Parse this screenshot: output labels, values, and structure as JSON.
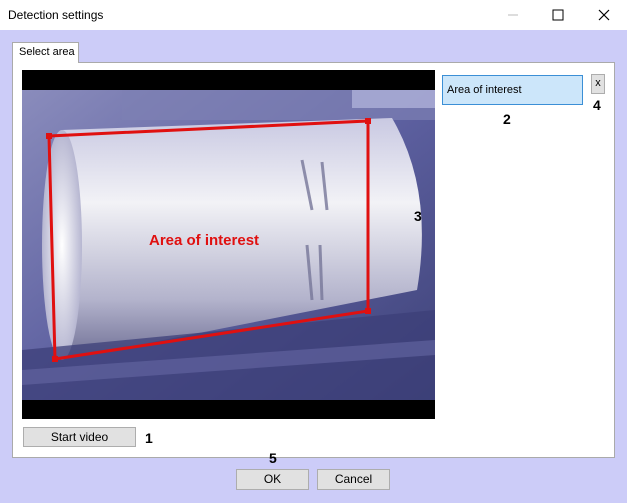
{
  "window": {
    "title": "Detection settings",
    "minimize_icon": "minimize-icon",
    "maximize_icon": "maximize-icon",
    "close_icon": "close-icon"
  },
  "tabs": [
    {
      "label": "Select area",
      "active": true
    }
  ],
  "video": {
    "overlay_label": "Area of interest",
    "polygon_color": "#e01010"
  },
  "areas_list": {
    "items": [
      {
        "label": "Area of interest",
        "selected": true
      }
    ],
    "delete_label": "x"
  },
  "buttons": {
    "start_video": "Start video",
    "ok": "OK",
    "cancel": "Cancel"
  },
  "callouts": {
    "c1": "1",
    "c2": "2",
    "c3": "3",
    "c4": "4",
    "c5": "5"
  },
  "colors": {
    "background": "#ccccf8",
    "selection_fill": "#cce6fa",
    "selection_border": "#3b8fd6"
  }
}
